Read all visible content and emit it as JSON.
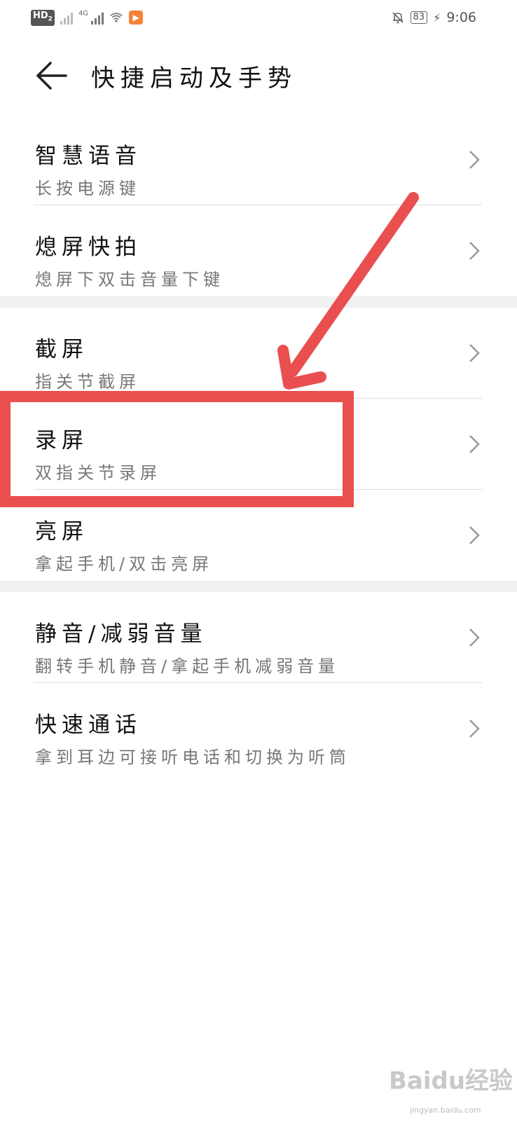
{
  "status_bar": {
    "hd_label": "HD",
    "hd_sub": "2",
    "network_label": "4G",
    "battery": "83",
    "time": "9:06"
  },
  "header": {
    "title": "快捷启动及手势"
  },
  "groups": [
    {
      "items": [
        {
          "title": "智慧语音",
          "subtitle": "长按电源键"
        },
        {
          "title": "熄屏快拍",
          "subtitle": "熄屏下双击音量下键"
        }
      ]
    },
    {
      "items": [
        {
          "title": "截屏",
          "subtitle": "指关节截屏"
        },
        {
          "title": "录屏",
          "subtitle": "双指关节录屏"
        },
        {
          "title": "亮屏",
          "subtitle": "拿起手机/双击亮屏"
        }
      ]
    },
    {
      "items": [
        {
          "title": "静音/减弱音量",
          "subtitle": "翻转手机静音/拿起手机减弱音量"
        },
        {
          "title": "快速通话",
          "subtitle": "拿到耳边可接听电话和切换为听筒"
        }
      ]
    }
  ],
  "annotation": {
    "highlight_color": "#e94f4f"
  },
  "watermark": {
    "text": "Baidu经验",
    "sub": "jingyan.baidu.com"
  }
}
